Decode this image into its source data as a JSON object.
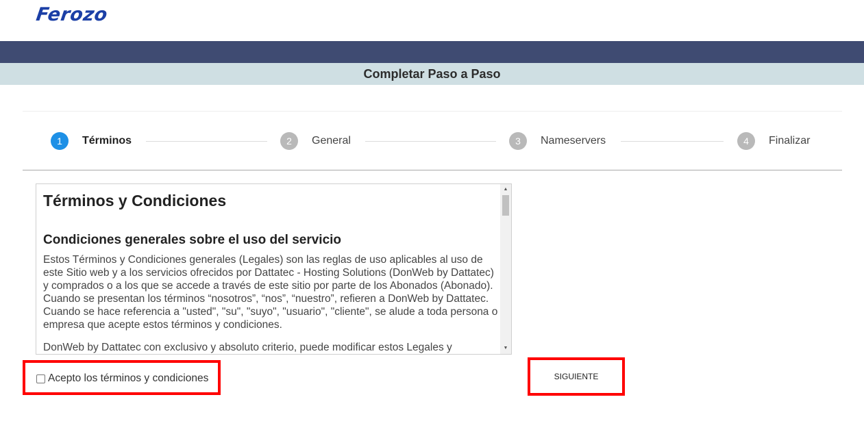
{
  "header": {
    "logo_text": "Ferozo"
  },
  "title_bar": {
    "title": "Completar Paso a Paso"
  },
  "steps": [
    {
      "number": "1",
      "label": "Términos",
      "active": true
    },
    {
      "number": "2",
      "label": "General",
      "active": false
    },
    {
      "number": "3",
      "label": "Nameservers",
      "active": false
    },
    {
      "number": "4",
      "label": "Finalizar",
      "active": false
    }
  ],
  "terms": {
    "title": "Términos y Condiciones",
    "subtitle": "Condiciones generales sobre el uso del servicio",
    "paragraphs": [
      "Estos Términos y Condiciones generales (Legales) son las reglas de uso aplicables al uso de este Sitio web y a los servicios ofrecidos por Dattatec - Hosting Solutions (DonWeb by Dattatec) y comprados o a los que se accede a través de este sitio por parte de los Abonados (Abonado). Cuando se presentan los términos “nosotros”, “nos”, “nuestro”, refieren a DonWeb by Dattatec. Cuando se hace referencia a \"usted\", \"su\", \"suyo\", \"usuario\", \"cliente\", se alude a toda persona o empresa que acepte estos términos y condiciones.",
      "DonWeb by Dattatec con exclusivo y absoluto criterio, puede modificar estos Legales y"
    ]
  },
  "accept": {
    "label": "Acepto los términos y condiciones",
    "checked": false
  },
  "next_button": {
    "label": "SIGUIENTE"
  },
  "colors": {
    "logo": "#1b3fa6",
    "navbar": "#3f4b72",
    "title_bar": "#cfdfe3",
    "active_step": "#1e90e6",
    "inactive_step": "#b9b9b9",
    "highlight": "#ff0000"
  }
}
